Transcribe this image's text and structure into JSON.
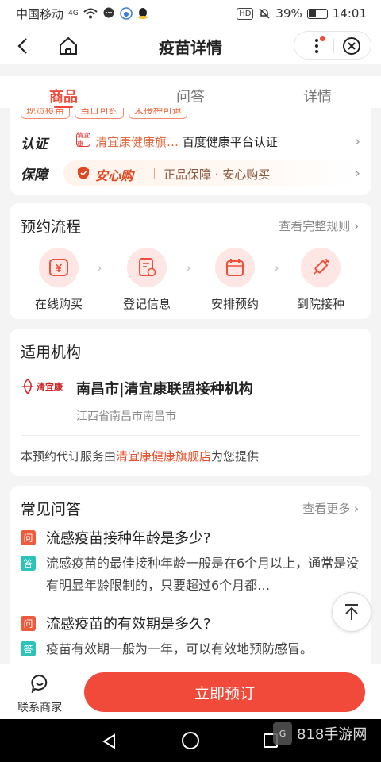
{
  "status_bar": {
    "carrier": "中国移动",
    "network": "4G",
    "hd": "HD",
    "battery": "39%",
    "battery_level": 0.39,
    "time": "14:01"
  },
  "nav": {
    "title": "疫苗详情"
  },
  "tabs": [
    {
      "label": "商品",
      "active": true
    },
    {
      "label": "问答",
      "active": false
    },
    {
      "label": "详情",
      "active": false
    }
  ],
  "product": {
    "tags": [
      "现货疫苗",
      "当日可约",
      "未接种可退"
    ],
    "cert_label": "认证",
    "cert_logo": "清宜康",
    "cert_store": "清宜康健康旗…",
    "cert_desc": "百度健康平台认证",
    "guarantee_label": "保障",
    "guarantee_brand": "安心购",
    "guarantee_text": "正品保障 · 安心购买"
  },
  "process": {
    "title": "预约流程",
    "link": "查看完整规则",
    "steps": [
      {
        "label": "在线购买",
        "icon": "yen-icon"
      },
      {
        "label": "登记信息",
        "icon": "register-icon"
      },
      {
        "label": "安排预约",
        "icon": "calendar-icon"
      },
      {
        "label": "到院接种",
        "icon": "syringe-icon"
      }
    ]
  },
  "institution": {
    "title": "适用机构",
    "logo_text": "清宜康",
    "name": "南昌市|清宜康联盟接种机构",
    "address": "江西省南昌市南昌市",
    "provider_prefix": "本预约代订服务由",
    "provider_store": "清宜康健康旗舰店",
    "provider_suffix": "为您提供"
  },
  "faq": {
    "title": "常见问答",
    "link": "查看更多",
    "q_badge": "问",
    "a_badge": "答",
    "items": [
      {
        "q": "流感疫苗接种年龄是多少?",
        "a": "流感疫苗的最佳接种年龄一般是在6个月以上，通常是没有明显年龄限制的，只要超过6个月都…"
      },
      {
        "q": "流感疫苗的有效期是多久?",
        "a": "疫苗有效期一般为一年，可以有效地预防感冒。"
      }
    ]
  },
  "bottom": {
    "merchant_label": "联系商家",
    "book_label": "立即预订"
  },
  "watermark": "818手游网",
  "colors": {
    "accent": "#f24a3a",
    "answer_badge": "#2cc3b8"
  }
}
